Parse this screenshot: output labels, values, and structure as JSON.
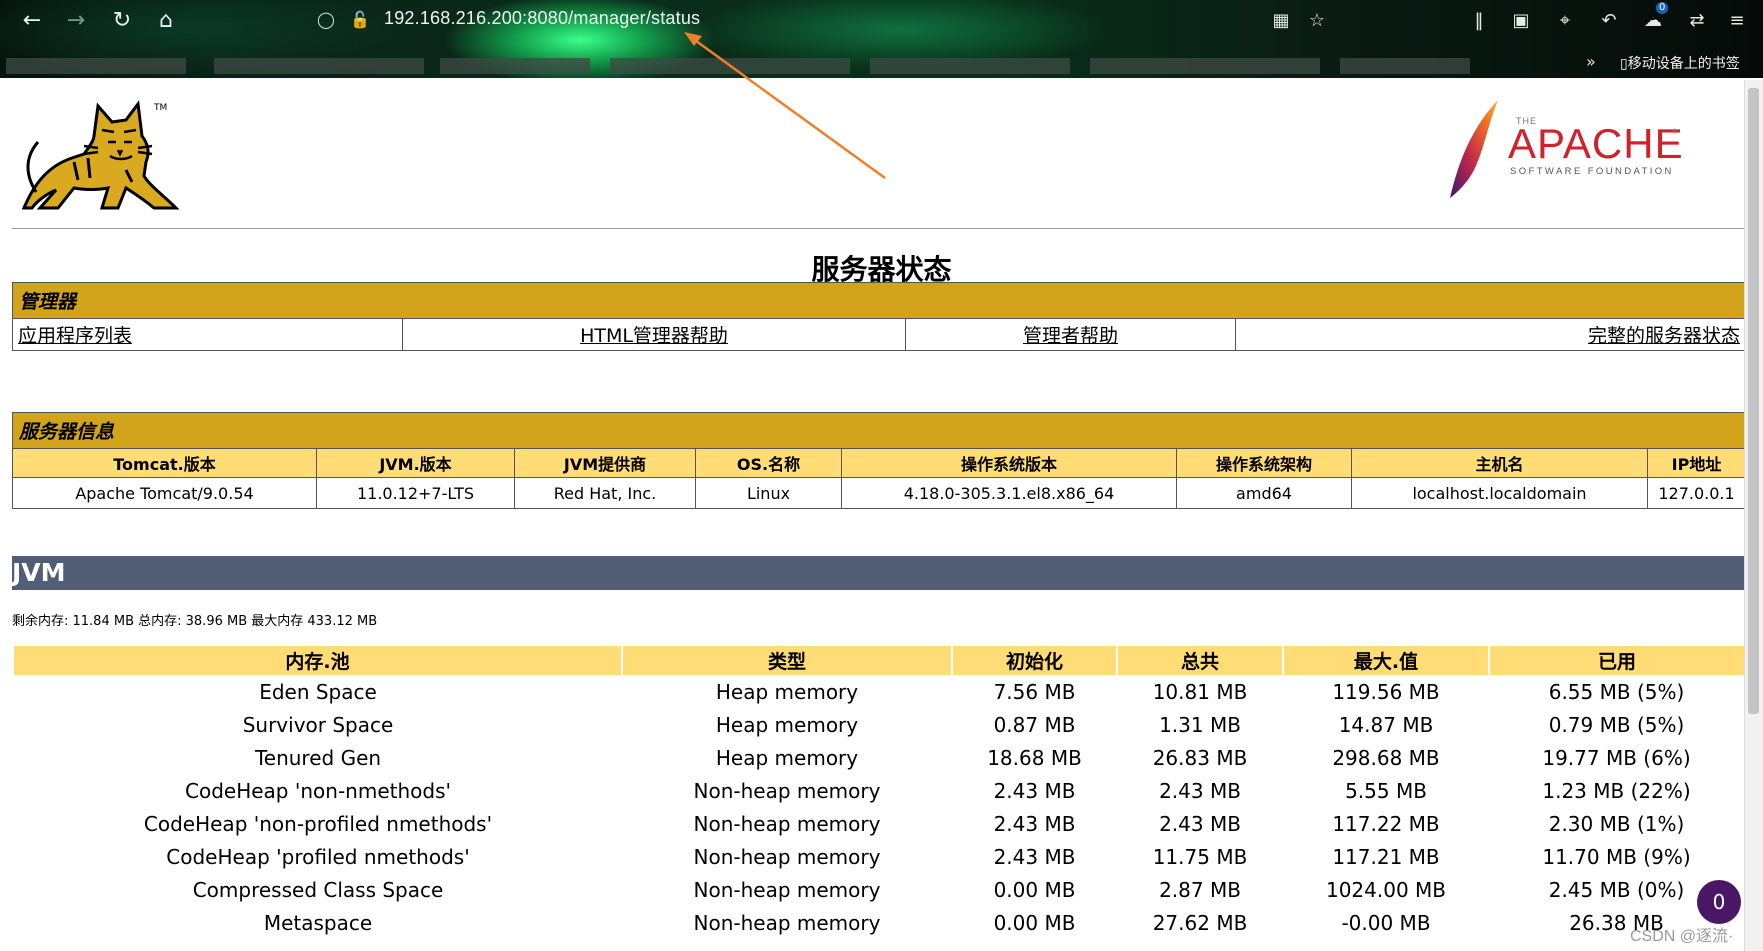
{
  "browser": {
    "url": "192.168.216.200:8080/manager/status",
    "badge_count": "0",
    "mobile_bookmarks": "移动设备上的书签"
  },
  "page": {
    "title": "服务器状态",
    "apache_logo": {
      "the": "THE",
      "name": "APACHE",
      "sub": "SOFTWARE FOUNDATION"
    }
  },
  "manager": {
    "heading": "管理器",
    "links": [
      "应用程序列表",
      "HTML管理器帮助",
      "管理者帮助",
      "完整的服务器状态"
    ]
  },
  "server_info": {
    "heading": "服务器信息",
    "columns": [
      "Tomcat.版本",
      "JVM.版本",
      "JVM提供商",
      "OS.名称",
      "操作系统版本",
      "操作系统架构",
      "主机名",
      "IP地址"
    ],
    "values": [
      "Apache Tomcat/9.0.54",
      "11.0.12+7-LTS",
      "Red Hat, Inc.",
      "Linux",
      "4.18.0-305.3.1.el8.x86_64",
      "amd64",
      "localhost.localdomain",
      "127.0.0.1"
    ]
  },
  "jvm": {
    "heading": "JVM",
    "memory_summary": "剩余内存:   11.84 MB 总内存:   38.96 MB 最大内存 433.12 MB",
    "pool_columns": [
      "内存.池",
      "类型",
      "初始化",
      "总共",
      "最大.值",
      "已用"
    ],
    "pools": [
      [
        "Eden Space",
        "Heap memory",
        "7.56 MB",
        "10.81 MB",
        "119.56 MB",
        "6.55 MB (5%)"
      ],
      [
        "Survivor Space",
        "Heap memory",
        "0.87 MB",
        "1.31 MB",
        "14.87 MB",
        "0.79 MB (5%)"
      ],
      [
        "Tenured Gen",
        "Heap memory",
        "18.68 MB",
        "26.83 MB",
        "298.68 MB",
        "19.77 MB (6%)"
      ],
      [
        "CodeHeap 'non-nmethods'",
        "Non-heap memory",
        "2.43 MB",
        "2.43 MB",
        "5.55 MB",
        "1.23 MB (22%)"
      ],
      [
        "CodeHeap 'non-profiled nmethods'",
        "Non-heap memory",
        "2.43 MB",
        "2.43 MB",
        "117.22 MB",
        "2.30 MB (1%)"
      ],
      [
        "CodeHeap 'profiled nmethods'",
        "Non-heap memory",
        "2.43 MB",
        "11.75 MB",
        "117.21 MB",
        "11.70 MB (9%)"
      ],
      [
        "Compressed Class Space",
        "Non-heap memory",
        "0.00 MB",
        "2.87 MB",
        "1024.00 MB",
        "2.45 MB (0%)"
      ],
      [
        "Metaspace",
        "Non-heap memory",
        "0.00 MB",
        "27.62 MB",
        "-0.00 MB",
        "26.38 MB"
      ]
    ]
  },
  "overlay": {
    "fab_count": "0",
    "watermark": "CSDN @逐流·"
  },
  "colors": {
    "manager_header": "#d2a41c",
    "column_header": "#ffdc75",
    "jvm_bar": "#525d76",
    "fab": "#4a1666"
  }
}
